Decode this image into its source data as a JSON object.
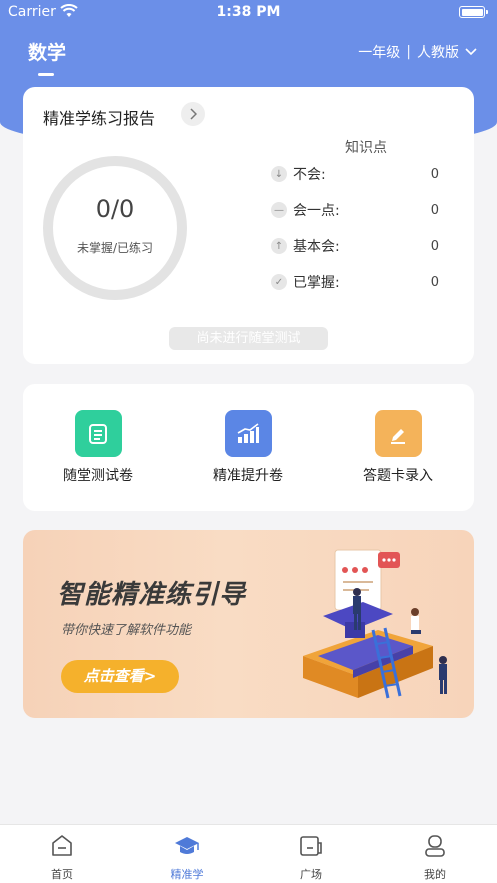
{
  "status": {
    "carrier": "Carrier",
    "time": "1:38 PM"
  },
  "nav": {
    "subject": "数学",
    "grade": "一年级",
    "separator": "|",
    "edition": "人教版"
  },
  "report": {
    "title": "精准学练习报告",
    "ring_value": "0/0",
    "ring_label": "未掌握/已练习",
    "kp_title": "知识点",
    "rows": [
      {
        "icon": "arrow-down-icon",
        "label": "不会:",
        "value": "0"
      },
      {
        "icon": "minus-icon",
        "label": "会一点:",
        "value": "0"
      },
      {
        "icon": "arrow-up-icon",
        "label": "基本会:",
        "value": "0"
      },
      {
        "icon": "check-icon",
        "label": "已掌握:",
        "value": "0"
      }
    ],
    "test_status": "尚未进行随堂测试"
  },
  "tools": [
    {
      "label": "随堂测试卷",
      "icon": "document-icon",
      "color": "#2fcf9c"
    },
    {
      "label": "精准提升卷",
      "icon": "bar-chart-icon",
      "color": "#5b86e5"
    },
    {
      "label": "答题卡录入",
      "icon": "edit-icon",
      "color": "#f4b35a"
    }
  ],
  "banner": {
    "title": "智能精准练引导",
    "subtitle": "带你快速了解软件功能",
    "button": "点击查看>"
  },
  "tabs": [
    {
      "label": "首页",
      "icon": "home-icon"
    },
    {
      "label": "精准学",
      "icon": "graduation-cap-icon",
      "active": true
    },
    {
      "label": "广场",
      "icon": "square-icon"
    },
    {
      "label": "我的",
      "icon": "user-icon"
    }
  ],
  "colors": {
    "header": "#6b8fe8",
    "accent": "#4f7ad8",
    "banner_button": "#f5b12c"
  }
}
